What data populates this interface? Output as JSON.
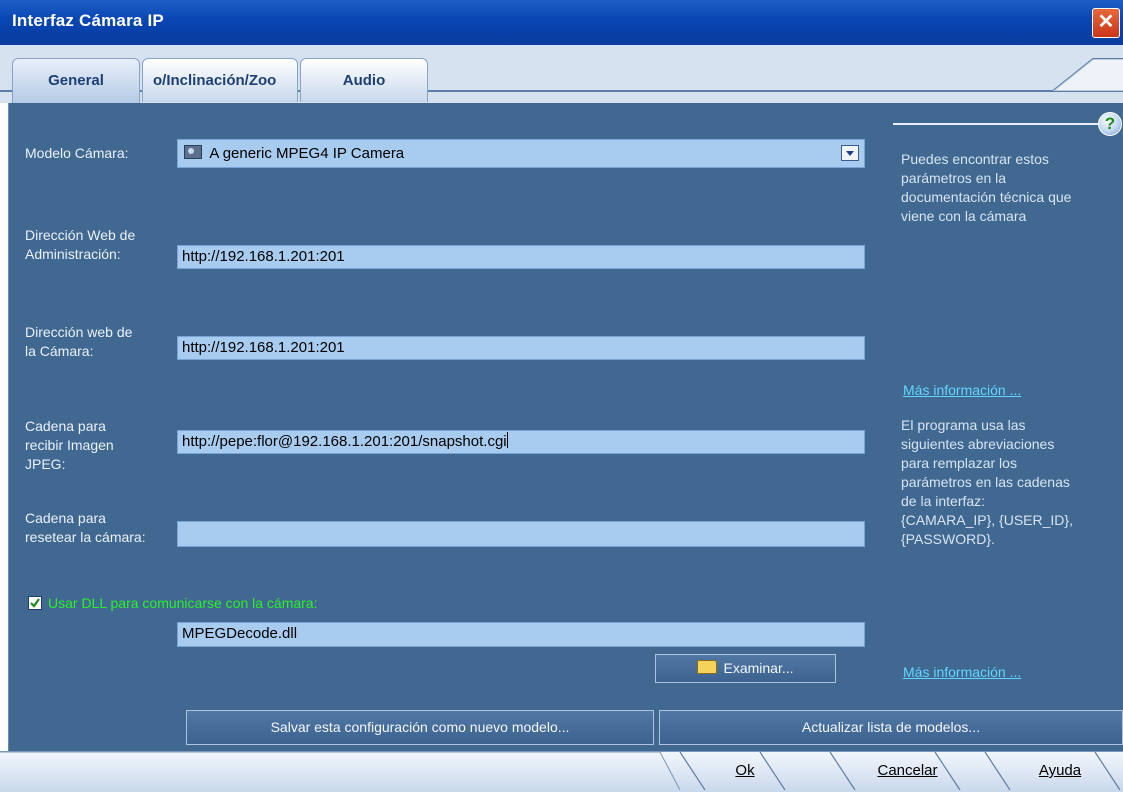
{
  "window": {
    "title": "Interfaz Cámara IP",
    "close_glyph": "✕"
  },
  "tabs": [
    {
      "label": "General",
      "active": true
    },
    {
      "label": "o/Inclinación/Zoo",
      "active": false
    },
    {
      "label": "Audio",
      "active": false
    }
  ],
  "form": {
    "camera_model_label": "Modelo Cámara:",
    "camera_model_value": "A generic MPEG4 IP Camera",
    "admin_url_label_1": "Dirección Web de",
    "admin_url_label_2": "Administración:",
    "admin_url_value": "http://192.168.1.201:201",
    "camera_url_label_1": "Dirección web de",
    "camera_url_label_2": "la Cámara:",
    "camera_url_value": "http://192.168.1.201:201",
    "jpeg_label_1": "Cadena para",
    "jpeg_label_2": "recibir Imagen",
    "jpeg_label_3": "JPEG:",
    "jpeg_value": "http://pepe:flor@192.168.1.201:201/snapshot.cgi",
    "reset_label_1": "Cadena para",
    "reset_label_2": "resetear la cámara:",
    "reset_value": "",
    "use_dll_label": "Usar DLL para comunicarse con la cámara:",
    "use_dll_checked": true,
    "dll_value": "MPEGDecode.dll",
    "browse_label": "Examinar..."
  },
  "help": {
    "icon": "?",
    "text1_lines": [
      "Puedes encontrar estos",
      "parámetros en la",
      "documentación técnica que",
      "viene con la cámara"
    ],
    "link1": "Más información ...",
    "text2_lines": [
      "El programa usa las",
      "siguientes abreviaciones",
      "para remplazar los",
      "parámetros en las cadenas",
      "de la interfaz:",
      "{CAMARA_IP}, {USER_ID},",
      "{PASSWORD}."
    ],
    "link2": "Más información ..."
  },
  "actions": {
    "save_model": "Salvar esta configuración como nuevo modelo...",
    "update_list": "Actualizar lista de modelos..."
  },
  "footer": {
    "ok": "Ok",
    "cancel": "Cancelar",
    "help": "Ayuda"
  },
  "colors": {
    "panel_bg": "#406890",
    "field_bg": "#a8cbf0",
    "link": "#63d6ff",
    "checkbox_label": "#2cf02c"
  }
}
